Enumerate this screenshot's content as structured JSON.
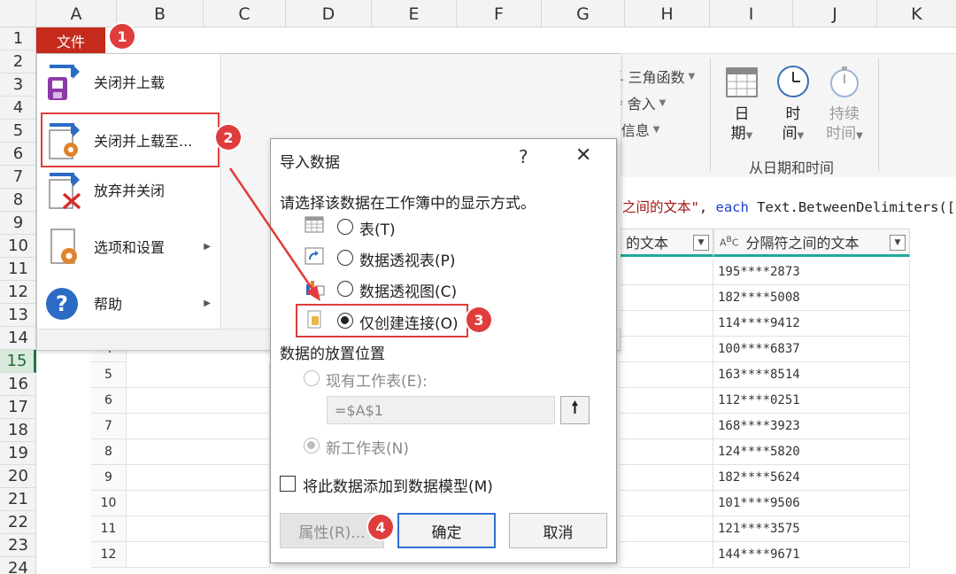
{
  "columns": [
    "A",
    "B",
    "C",
    "D",
    "E",
    "F",
    "G",
    "H",
    "I",
    "J",
    "K"
  ],
  "rows": [
    "1",
    "2",
    "3",
    "4",
    "5",
    "6",
    "7",
    "8",
    "9",
    "10",
    "11",
    "12",
    "13",
    "14",
    "15",
    "16",
    "17",
    "18",
    "19",
    "20",
    "21",
    "22",
    "23",
    "24"
  ],
  "active_row": "15",
  "file_menu": {
    "tab_label": "文件",
    "items": [
      {
        "label": "关闭并上载",
        "icon": "close-load-icon"
      },
      {
        "label": "关闭并上载至...",
        "icon": "close-load-to-icon"
      },
      {
        "label": "放弃并关闭",
        "icon": "discard-close-icon"
      },
      {
        "label": "选项和设置",
        "icon": "options-icon"
      },
      {
        "label": "帮助",
        "icon": "help-icon"
      }
    ]
  },
  "ribbon": {
    "small_items": [
      "三角函数",
      "舍入",
      "信息"
    ],
    "date_btn": {
      "line1": "日",
      "line2": "期"
    },
    "time_btn": {
      "line1": "时",
      "line2": "间"
    },
    "duration_btn": {
      "line1": "持续",
      "line2": "时间"
    },
    "group_label": "从日期和时间"
  },
  "formula": {
    "part1": "之间的文本\"",
    "part2": ", ",
    "keyword": "each",
    "part3": " Text.BetweenDelimiters(["
  },
  "table": {
    "col1_header": "的文本",
    "col2_header": "分隔符之间的文本",
    "row_numbers": [
      "4",
      "5",
      "6",
      "7",
      "8",
      "9",
      "10",
      "11",
      "12"
    ],
    "values": [
      "195****2873",
      "182****5008",
      "114****9412",
      "100****6837",
      "163****8514",
      "112****0251",
      "168****3923",
      "124****5820",
      "182****5624",
      "101****9506",
      "121****3575",
      "144****9671"
    ]
  },
  "dialog": {
    "title": "导入数据",
    "help": "?",
    "close": "✕",
    "prompt": "请选择该数据在工作簿中的显示方式。",
    "options": [
      "表(T)",
      "数据透视表(P)",
      "数据透视图(C)",
      "仅创建连接(O)"
    ],
    "selected_option": "仅创建连接(O)",
    "placement_label": "数据的放置位置",
    "existing_sheet": "现有工作表(E):",
    "ref_value": "=$A$1",
    "new_sheet": "新工作表(N)",
    "add_to_model": "将此数据添加到数据模型(M)",
    "btn_props": "属性(R)...",
    "btn_ok": "确定",
    "btn_cancel": "取消"
  },
  "badges": [
    "1",
    "2",
    "3",
    "4"
  ],
  "colors": {
    "file_tab": "#c42b1c",
    "annotation": "#e03c3c",
    "teal": "#1fa89a",
    "excel_green": "#217346"
  }
}
